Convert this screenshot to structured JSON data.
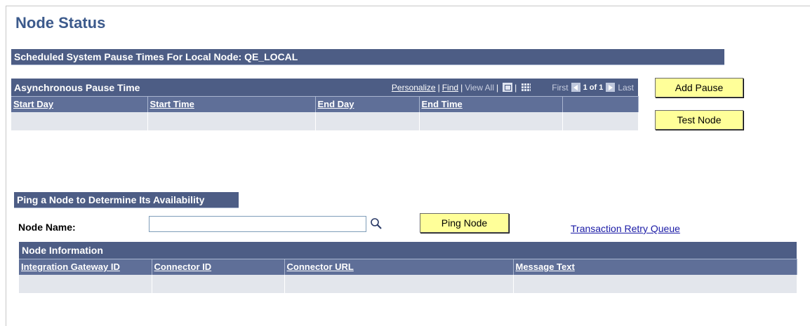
{
  "page_title": "Node Status",
  "scheduled": {
    "title": "Scheduled System Pause Times For Local Node: QE_LOCAL"
  },
  "async_grid": {
    "title": "Asynchronous Pause Time",
    "personalize": "Personalize",
    "find": "Find",
    "view_all": "View All",
    "first": "First",
    "count": "1 of 1",
    "last": "Last",
    "columns": [
      "Start Day",
      "Start Time",
      "End Day",
      "End Time",
      ""
    ]
  },
  "buttons": {
    "add_pause": "Add Pause",
    "test_node": "Test Node",
    "ping_node": "Ping Node"
  },
  "ping": {
    "title": "Ping a Node to Determine Its Availability",
    "node_name_label": "Node Name:",
    "node_name_value": ""
  },
  "links": {
    "transaction_retry_queue": "Transaction Retry Queue"
  },
  "node_info": {
    "title": "Node Information",
    "columns": [
      "Integration Gateway ID",
      "Connector ID",
      "Connector URL",
      "Message Text"
    ]
  },
  "icons": {
    "lookup": "magnifier-icon",
    "zoom": "zoom-icon",
    "download": "spreadsheet-icon",
    "prev": "prev-arrow-icon",
    "next": "next-arrow-icon"
  }
}
